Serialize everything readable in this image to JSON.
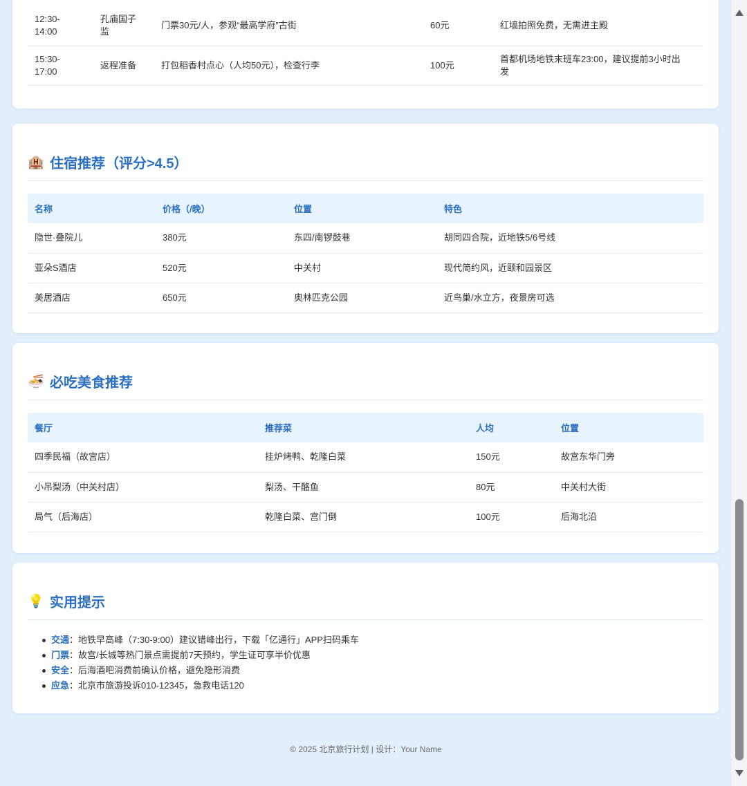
{
  "itinerary": {
    "rows": [
      {
        "time": "12:30-\n14:00",
        "activity": "孔庙国子\n监",
        "detail": "门票30元/人，参观“最高学府”古街",
        "cost": "60元",
        "note": "红墙拍照免费，无需进主殿"
      },
      {
        "time": "15:30-\n17:00",
        "activity": "返程准备",
        "detail": "打包稻香村点心（人均50元），检查行李",
        "cost": "100元",
        "note": "首都机场地铁末班车23:00，建议提前3小时出\n发"
      }
    ]
  },
  "hotels": {
    "title": "住宿推荐（评分>4.5）",
    "icon": "hotel-icon",
    "headers": [
      "名称",
      "价格（/晚）",
      "位置",
      "特色"
    ],
    "rows": [
      [
        "隐世·叠院儿",
        "380元",
        "东四/南锣鼓巷",
        "胡同四合院，近地铁5/6号线"
      ],
      [
        "亚朵S酒店",
        "520元",
        "中关村",
        "现代简约风，近颐和园景区"
      ],
      [
        "美居酒店",
        "650元",
        "奥林匹克公园",
        "近鸟巢/水立方，夜景房可选"
      ]
    ]
  },
  "food": {
    "title": "必吃美食推荐",
    "icon": "noodle-bowl-icon",
    "headers": [
      "餐厅",
      "推荐菜",
      "人均",
      "位置"
    ],
    "rows": [
      [
        "四季民福（故宫店）",
        "挂炉烤鸭、乾隆白菜",
        "150元",
        "故宫东华门旁"
      ],
      [
        "小吊梨汤（中关村店）",
        "梨汤、干酪鱼",
        "80元",
        "中关村大街"
      ],
      [
        "局气（后海店）",
        "乾隆白菜、宫门倒",
        "100元",
        "后海北沿"
      ]
    ]
  },
  "tips": {
    "title": "实用提示",
    "icon": "lightbulb-icon",
    "items": [
      {
        "label": "交通",
        "text": "：地铁早高峰（7:30-9:00）建议错峰出行，下载「亿通行」APP扫码乘车"
      },
      {
        "label": "门票",
        "text": "：故宫/长城等热门景点需提前7天预约，学生证可享半价优惠"
      },
      {
        "label": "安全",
        "text": "：后海酒吧消费前确认价格，避免隐形消费"
      },
      {
        "label": "应急",
        "text": "：北京市旅游投诉010-12345，急救电话120"
      }
    ]
  },
  "footer": {
    "text": "© 2025 北京旅行计划 | 设计：Your Name"
  },
  "colors": {
    "accent": "#2b6fc0",
    "header_bg": "#e7f3fd",
    "page_bg": "#e3f0fc"
  }
}
